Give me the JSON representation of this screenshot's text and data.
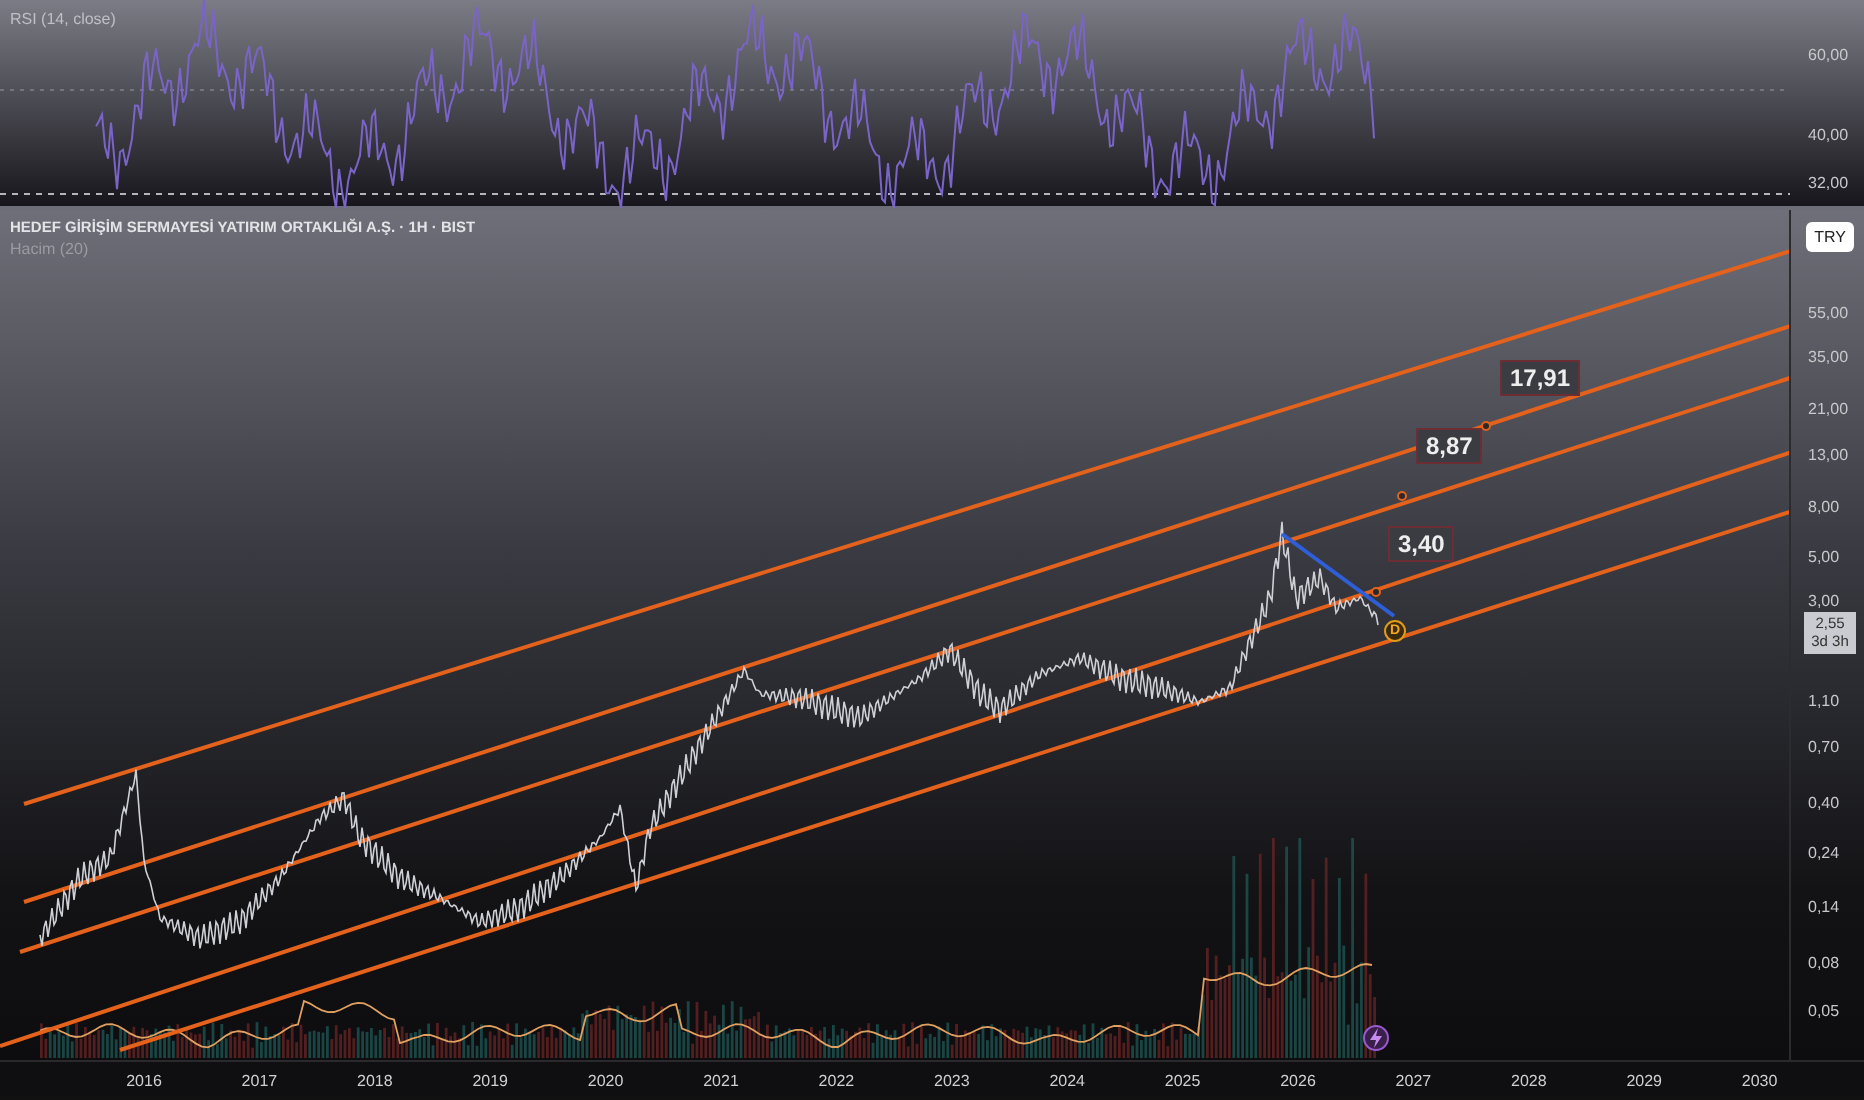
{
  "rsi_pane": {
    "legend": "RSI (14, close)",
    "axis_labels": [
      "60,00",
      "40,00",
      "32,00"
    ]
  },
  "main_pane": {
    "title": "HEDEF GİRİŞİM SERMAYESİ YATIRIM ORTAKLIĞI A.Ş. · 1H · BIST",
    "volume_legend": "Hacim (20)",
    "currency": "TRY",
    "axis_labels": [
      "55,00",
      "35,00",
      "21,00",
      "13,00",
      "8,00",
      "5,00",
      "3,00",
      "1,10",
      "0,70",
      "0,40",
      "0,24",
      "0,14",
      "0,08",
      "0,05"
    ],
    "last_price": {
      "value": "2,55",
      "countdown": "3d 3h"
    },
    "target_labels": [
      "3,40",
      "8,87",
      "17,91"
    ],
    "marker": "D"
  },
  "time_axis": [
    "2016",
    "2017",
    "2018",
    "2019",
    "2020",
    "2021",
    "2022",
    "2023",
    "2024",
    "2025",
    "2026",
    "2027",
    "2028",
    "2029",
    "2030"
  ]
}
